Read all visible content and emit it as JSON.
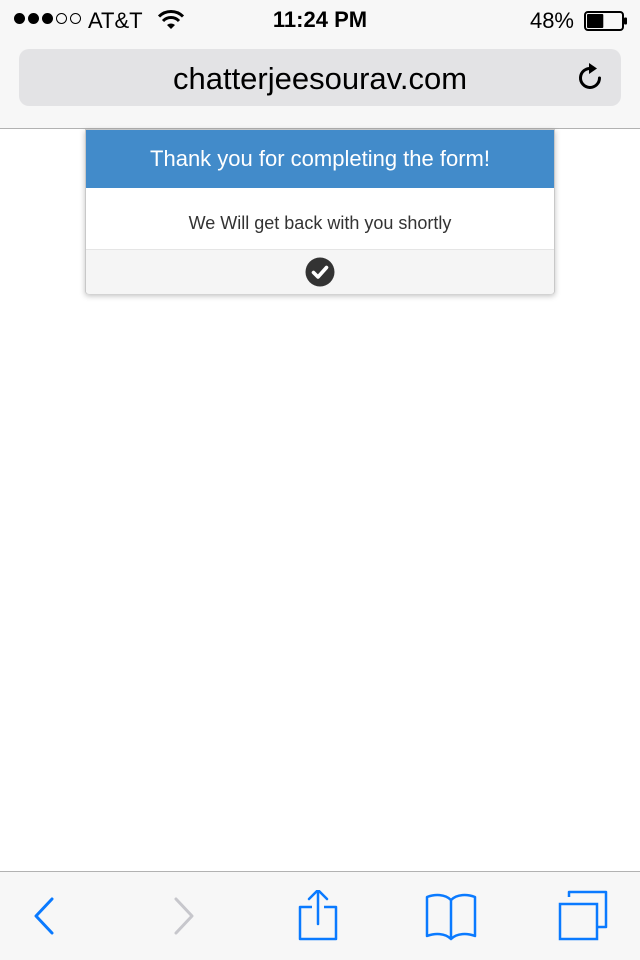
{
  "status_bar": {
    "carrier": "AT&T",
    "time": "11:24 PM",
    "battery_percent": "48%",
    "battery_level": 0.48,
    "signal_bars_filled": 3,
    "signal_bars_total": 5,
    "icons": [
      "signal-dots-icon",
      "wifi-icon",
      "battery-icon"
    ]
  },
  "address_bar": {
    "url": "chatterjeesourav.com",
    "reload_icon": "reload-icon"
  },
  "modal": {
    "title": "Thank you for completing the form!",
    "message": "We Will get back with you shortly",
    "confirm_icon": "check-circle-icon",
    "header_color": "#428bca"
  },
  "toolbar": {
    "icons": [
      "back-icon",
      "forward-icon",
      "share-icon",
      "bookmarks-icon",
      "tabs-icon"
    ],
    "accent_color": "#0a7aff",
    "disabled_color": "#c7c7cc"
  }
}
